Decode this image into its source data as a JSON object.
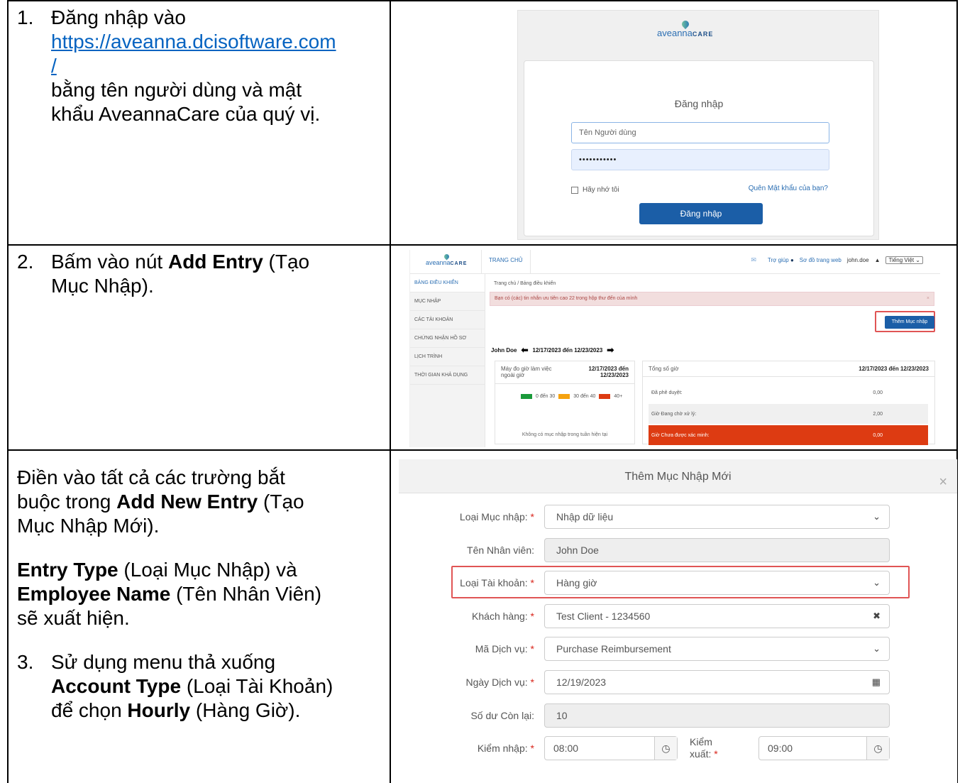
{
  "rows": [
    {
      "step": "1.",
      "line1": "Đăng nhập vào",
      "link1": "https://aveanna.dcisoftware.com",
      "link2": "/",
      "line2": "bằng tên người dùng và mật",
      "line3": "khẩu AveannaCare của quý vị."
    },
    {
      "step": "2.",
      "pre": "Bấm vào nút ",
      "bold": "Add Entry",
      "post": " (Tạo",
      "line2": "Mục Nhập)."
    },
    {
      "p1a": "Điền vào tất cả các trường bắt",
      "p1b_pre": "buộc trong ",
      "p1b_bold": "Add New Entry",
      "p1b_post": " (Tạo",
      "p1c": "Mục Nhập Mới).",
      "p2a_bold": "Entry Type",
      "p2a_post": " (Loại Mục Nhập) và",
      "p2b_bold": "Employee Name",
      "p2b_post": " (Tên Nhân Viên)",
      "p2c": "sẽ xuất hiện.",
      "step": "3.",
      "p3a": "Sử dụng menu thả xuống",
      "p3b_bold": "Account Type",
      "p3b_post": " (Loại Tài Khoản)",
      "p3c_pre": "để chọn ",
      "p3c_bold": "Hourly",
      "p3c_post": " (Hàng Giờ)."
    }
  ],
  "brand": {
    "word1": "aveanna",
    "word2": "CARE"
  },
  "login": {
    "title": "Đăng nhập",
    "username_placeholder": "Tên Người dùng",
    "password_value": "•••••••••••",
    "remember_label": "Hãy nhớ tôi",
    "forgot_label": "Quên Mật khẩu của bạn?",
    "submit_label": "Đăng nhập"
  },
  "dashboard": {
    "nav_home": "TRANG CHỦ",
    "help": "Trợ giúp",
    "sitemap": "Sơ đồ trang web",
    "user": "john.doe",
    "language": "Tiếng Việt",
    "sidebar": [
      "BẢNG ĐIỀU KHIỂN",
      "MỤC NHẬP",
      "CÁC TÀI KHOẢN",
      "CHỨNG NHẬN HỒ SƠ",
      "LỊCH TRÌNH",
      "THỜI GIAN KHẢ DỤNG"
    ],
    "breadcrumb": "Trang chủ / Bảng điều khiển",
    "alert": "Bạn có (các) tin nhắn ưu tiên cao 22 trong hộp thư đến của mình",
    "add_button": "Thêm Mục nhập",
    "employee": "John Doe",
    "week_range": "12/17/2023 đến 12/23/2023",
    "overtime_title": "Máy đo giờ làm việc ngoài giờ",
    "overtime_range": "12/17/2023 đến 12/23/2023",
    "legend": [
      "0 đến 30",
      "30 đến 40",
      "40+"
    ],
    "legend_colors": [
      "#1a9a3a",
      "#f5a20f",
      "#dd3b12"
    ],
    "no_entries": "Không có mục nhập trong tuần hiện tại",
    "total_title": "Tổng số giờ",
    "total_range": "12/17/2023 đến 12/23/2023",
    "rows": [
      {
        "label": "Đã phê duyệt:",
        "value": "0,00"
      },
      {
        "label": "Giờ Đang chờ xử lý:",
        "value": "2,00"
      },
      {
        "label": "Giờ Chưa được xác minh:",
        "value": "0,00"
      }
    ]
  },
  "modal": {
    "title": "Thêm Mục Nhập Mới",
    "fields": [
      {
        "label": "Loại Mục nhập:",
        "value": "Nhập dữ liệu",
        "required": "*",
        "suffix": "⌄"
      },
      {
        "label": "Tên Nhân viên:",
        "value": "John Doe"
      },
      {
        "label": "Loại Tài khoản:",
        "value": "Hàng giờ",
        "required": "*",
        "suffix": "⌄"
      },
      {
        "label": "Khách hàng:",
        "value": "Test Client - 1234560",
        "required": "*",
        "suffix": "✖"
      },
      {
        "label": "Mã Dịch vụ:",
        "value": "Purchase Reimbursement",
        "required": "*",
        "suffix": "⌄"
      },
      {
        "label": "Ngày Dịch vụ:",
        "value": "12/19/2023",
        "required": "*",
        "suffix": "▦"
      },
      {
        "label": "Số dư Còn lại:",
        "value": "10"
      }
    ],
    "checkin_label": "Kiểm nhập:",
    "checkin_value": "08:00",
    "checkout_label_1": "Kiểm",
    "checkout_label_2": "xuất:",
    "checkout_value": "09:00",
    "required": "*"
  }
}
